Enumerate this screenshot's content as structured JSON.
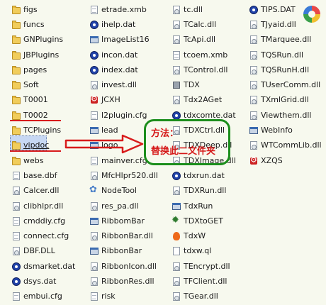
{
  "columns": [
    [
      {
        "name": "figs",
        "icon": "folder"
      },
      {
        "name": "funcs",
        "icon": "folder"
      },
      {
        "name": "GNPlugins",
        "icon": "folder"
      },
      {
        "name": "JBPlugins",
        "icon": "folder"
      },
      {
        "name": "pages",
        "icon": "folder"
      },
      {
        "name": "Soft",
        "icon": "folder"
      },
      {
        "name": "T0001",
        "icon": "folder"
      },
      {
        "name": "T0002",
        "icon": "folder"
      },
      {
        "name": "TCPlugins",
        "icon": "folder"
      },
      {
        "name": "vipdoc",
        "icon": "folder"
      },
      {
        "name": "webs",
        "icon": "folder"
      },
      {
        "name": "base.dbf",
        "icon": "file"
      },
      {
        "name": "Calcer.dll",
        "icon": "dll"
      },
      {
        "name": "clibhlpr.dll",
        "icon": "dll"
      },
      {
        "name": "cmddiy.cfg",
        "icon": "file"
      },
      {
        "name": "connect.cfg",
        "icon": "file"
      },
      {
        "name": "DBF.DLL",
        "icon": "dll"
      },
      {
        "name": "dsmarket.dat",
        "icon": "dat"
      },
      {
        "name": "dsys.dat",
        "icon": "dat"
      },
      {
        "name": "embui.cfg",
        "icon": "file"
      }
    ],
    [
      {
        "name": "etrade.xmb",
        "icon": "file"
      },
      {
        "name": "ihelp.dat",
        "icon": "dat"
      },
      {
        "name": "ImageList16",
        "icon": "app"
      },
      {
        "name": "incon.dat",
        "icon": "dat"
      },
      {
        "name": "index.dat",
        "icon": "dat"
      },
      {
        "name": "invest.dll",
        "icon": "dll"
      },
      {
        "name": "JCXH",
        "icon": "exe-red"
      },
      {
        "name": "l2plugin.cfg",
        "icon": "file"
      },
      {
        "name": "lead",
        "icon": "app"
      },
      {
        "name": "logo",
        "icon": "app"
      },
      {
        "name": "mainver.cfg",
        "icon": "file"
      },
      {
        "name": "MfcHlpr520.dll",
        "icon": "dll"
      },
      {
        "name": "NodeTool",
        "icon": "gear"
      },
      {
        "name": "res_pa.dll",
        "icon": "dll"
      },
      {
        "name": "RibbomBar",
        "icon": "app"
      },
      {
        "name": "RibbonBar.dll",
        "icon": "dll"
      },
      {
        "name": "RibbonBar",
        "icon": "app"
      },
      {
        "name": "RibbonIcon.dll",
        "icon": "dll"
      },
      {
        "name": "RibbonRes.dll",
        "icon": "dll"
      },
      {
        "name": "risk",
        "icon": "file"
      }
    ],
    [
      {
        "name": "tc.dll",
        "icon": "dll"
      },
      {
        "name": "TCalc.dll",
        "icon": "dll"
      },
      {
        "name": "TcApi.dll",
        "icon": "dll"
      },
      {
        "name": "tcoem.xmb",
        "icon": "file"
      },
      {
        "name": "TControl.dll",
        "icon": "dll"
      },
      {
        "name": "TDX",
        "icon": "gray-cube"
      },
      {
        "name": "Tdx2AGet",
        "icon": "dll"
      },
      {
        "name": "tdxcomte.dat",
        "icon": "dat"
      },
      {
        "name": "TDXCtrl.dll",
        "icon": "dll"
      },
      {
        "name": "TDXDeep.dll",
        "icon": "dll"
      },
      {
        "name": "TDXImage.dll",
        "icon": "dll"
      },
      {
        "name": "tdxrun.dat",
        "icon": "dat"
      },
      {
        "name": "TDXRun.dll",
        "icon": "dll"
      },
      {
        "name": "TdxRun",
        "icon": "app"
      },
      {
        "name": "TDXtoGET",
        "icon": "green-gear"
      },
      {
        "name": "TdxW",
        "icon": "exe-flame"
      },
      {
        "name": "tdxw.ql",
        "icon": "ql"
      },
      {
        "name": "TEncrypt.dll",
        "icon": "dll"
      },
      {
        "name": "TFClient.dll",
        "icon": "dll"
      },
      {
        "name": "TGear.dll",
        "icon": "dll"
      }
    ],
    [
      {
        "name": "TIPS.DAT",
        "icon": "dat"
      },
      {
        "name": "TJyaid.dll",
        "icon": "dll"
      },
      {
        "name": "TMarquee.dll",
        "icon": "dll"
      },
      {
        "name": "TQSRun.dll",
        "icon": "dll"
      },
      {
        "name": "TQSRunH.dll",
        "icon": "dll"
      },
      {
        "name": "TUserComm.dll",
        "icon": "dll"
      },
      {
        "name": "TXmlGrid.dll",
        "icon": "dll"
      },
      {
        "name": "Viewthem.dll",
        "icon": "dll"
      },
      {
        "name": "WebInfo",
        "icon": "app"
      },
      {
        "name": "WTCommLib.dll",
        "icon": "dll"
      },
      {
        "name": "XZQS",
        "icon": "exe-red"
      }
    ]
  ],
  "selected_item": "vipdoc",
  "annotation": {
    "line1": "方法：",
    "line2": "替换此二文件夹",
    "arrow_color": "#d81c1c",
    "box_color": "#1c8e1c",
    "text_color": "#d51818"
  },
  "colors": {
    "background": "#f7f9ee",
    "selection": "#c7d8f3"
  }
}
